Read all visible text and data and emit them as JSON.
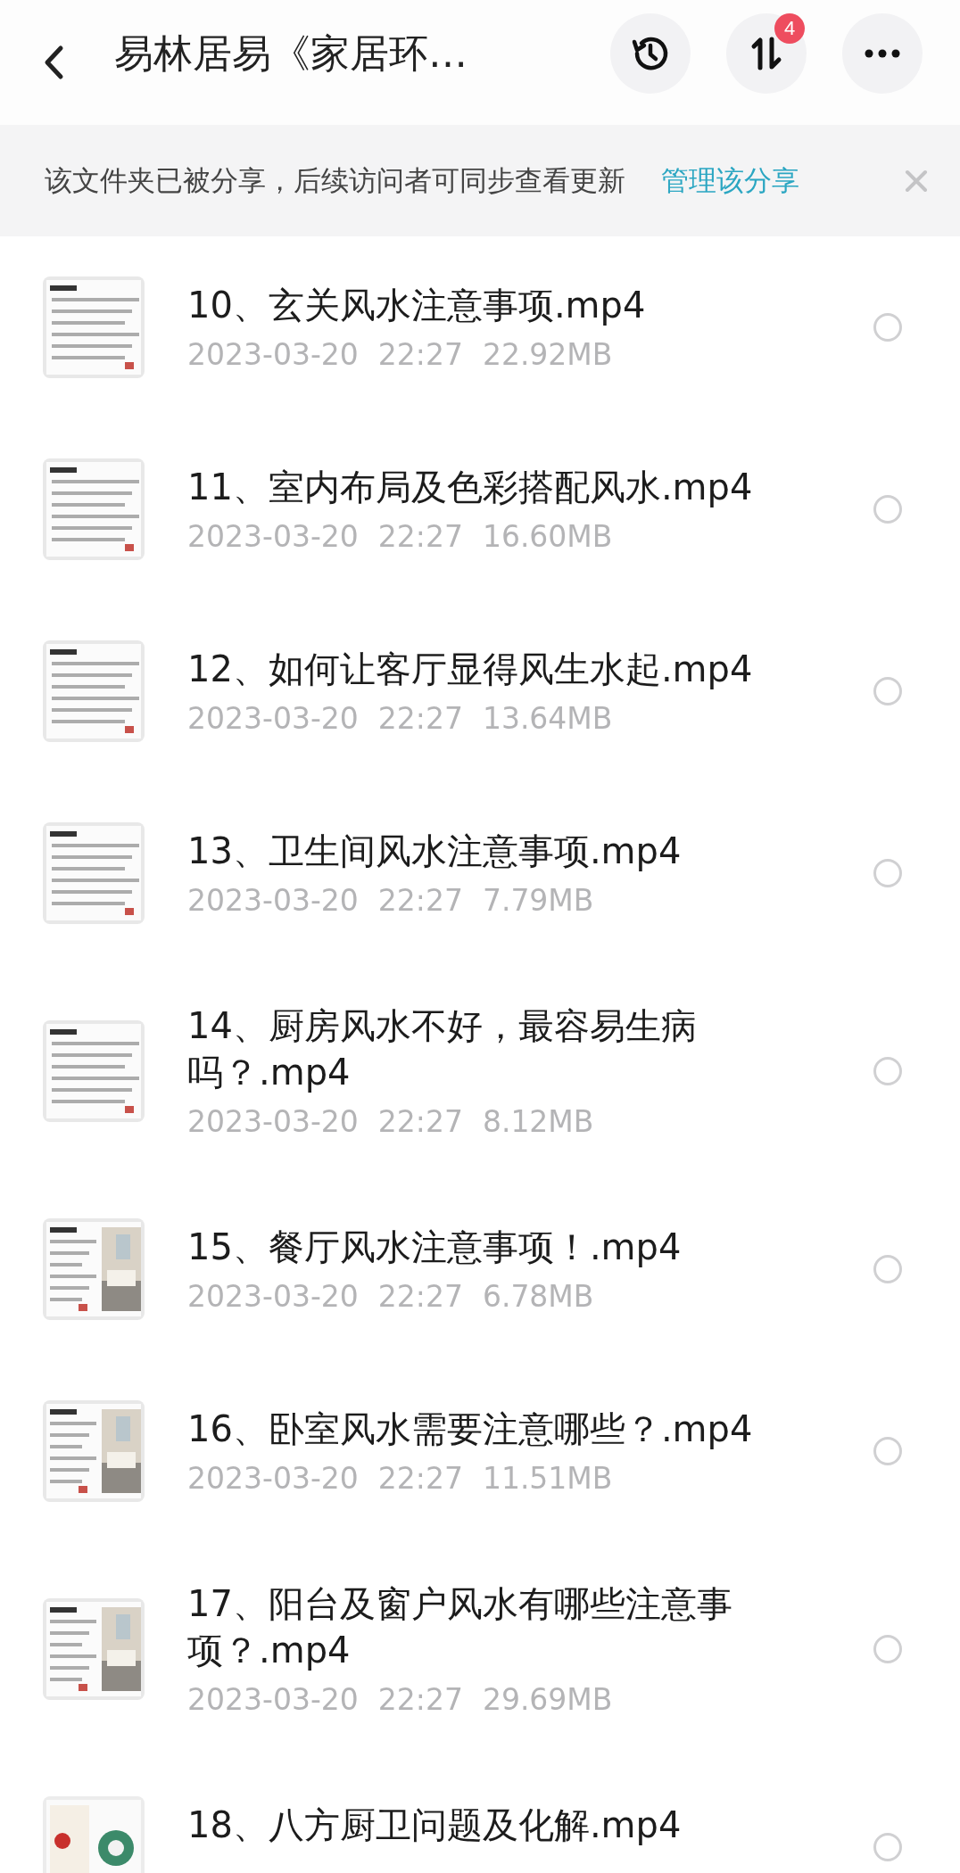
{
  "header": {
    "title": "易林居易《家居环…",
    "badge": "4"
  },
  "banner": {
    "message": "该文件夹已被分享，后续访问者可同步查看更新",
    "link": "管理该分享"
  },
  "files": [
    {
      "name": "10、玄关风水注意事项.mp4",
      "date": "2023-03-20",
      "time": "22:27",
      "size": "22.92MB",
      "selected": false
    },
    {
      "name": "11、室内布局及色彩搭配风水.mp4",
      "date": "2023-03-20",
      "time": "22:27",
      "size": "16.60MB",
      "selected": false
    },
    {
      "name": "12、如何让客厅显得风生水起.mp4",
      "date": "2023-03-20",
      "time": "22:27",
      "size": "13.64MB",
      "selected": false
    },
    {
      "name": "13、卫生间风水注意事项.mp4",
      "date": "2023-03-20",
      "time": "22:27",
      "size": "7.79MB",
      "selected": false
    },
    {
      "name": "14、厨房风水不好，最容易生病吗？.mp4",
      "date": "2023-03-20",
      "time": "22:27",
      "size": "8.12MB",
      "selected": false
    },
    {
      "name": "15、餐厅风水注意事项！.mp4",
      "date": "2023-03-20",
      "time": "22:27",
      "size": "6.78MB",
      "selected": false
    },
    {
      "name": "16、卧室风水需要注意哪些？.mp4",
      "date": "2023-03-20",
      "time": "22:27",
      "size": "11.51MB",
      "selected": false
    },
    {
      "name": "17、阳台及窗户风水有哪些注意事项？.mp4",
      "date": "2023-03-20",
      "time": "22:27",
      "size": "29.69MB",
      "selected": false
    },
    {
      "name": "18、八方厨卫问题及化解.mp4",
      "selected": false
    }
  ]
}
